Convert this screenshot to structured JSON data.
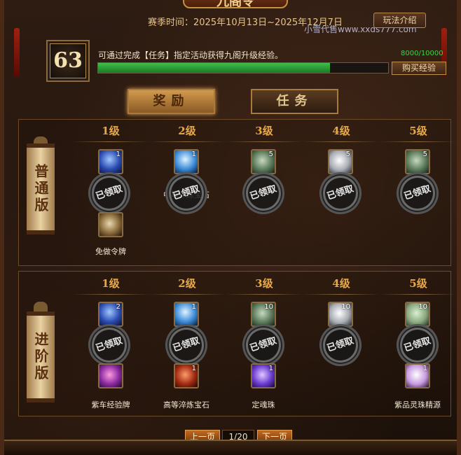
{
  "header": {
    "title": "九阁令",
    "season_text": "赛季时间：2025年10月13日~2025年12月7日",
    "rules_button": "玩法介绍",
    "watermark": "小雪代售www.xxds777.com"
  },
  "progress": {
    "level": "63",
    "tip": "可通过完成【任务】指定活动获得九阁升级经验。",
    "exp_text": "8000/10000",
    "exp_fraction": 0.8,
    "buy_button": "购买经验"
  },
  "tabs": {
    "reward": "奖励",
    "task": "任务"
  },
  "tiers": [
    "1级",
    "2级",
    "3级",
    "4级",
    "5级"
  ],
  "normal": {
    "label": "普通版",
    "items": [
      {
        "icon": "blue-gem-icon",
        "count": "1",
        "name": "",
        "claimed": true
      },
      {
        "icon": "sky-gem-icon",
        "count": "1",
        "name": "中等淬炼宝石",
        "claimed": true
      },
      {
        "icon": "coin-icon",
        "count": "5",
        "name": "",
        "claimed": true
      },
      {
        "icon": "silver-ingot-icon",
        "count": "5",
        "name": "",
        "claimed": true
      },
      {
        "icon": "coin-icon",
        "count": "5",
        "name": "",
        "claimed": true
      }
    ],
    "extra_item_name": "免做令牌"
  },
  "advanced": {
    "label": "进阶版",
    "items_top": [
      {
        "icon": "blue-gem-icon",
        "count": "2",
        "claimed": true
      },
      {
        "icon": "sky-gem-icon",
        "count": "1",
        "claimed": true
      },
      {
        "icon": "coin-icon",
        "count": "10",
        "claimed": true
      },
      {
        "icon": "silver-ingot-icon",
        "count": "10",
        "claimed": true
      },
      {
        "icon": "jade-ingot-icon",
        "count": "10",
        "claimed": true
      }
    ],
    "items_bottom": [
      {
        "icon": "purple-box-icon",
        "count": "",
        "name": "紫车经验牌"
      },
      {
        "icon": "red-gem-icon",
        "count": "1",
        "name": "高等淬炼宝石"
      },
      {
        "icon": "violet-orb-icon",
        "count": "1",
        "name": "定魂珠"
      },
      {
        "icon": "",
        "count": "",
        "name": ""
      },
      {
        "icon": "pearl-icon",
        "count": "1",
        "name": "紫品灵珠精源"
      }
    ]
  },
  "stamp_text": "已领取",
  "pager": {
    "prev": "上一页",
    "page": "1/20",
    "next": "下一页"
  },
  "colors": {
    "accent": "#e6a84a",
    "exp_green": "#3fd24a",
    "pager": "#c06a20"
  }
}
